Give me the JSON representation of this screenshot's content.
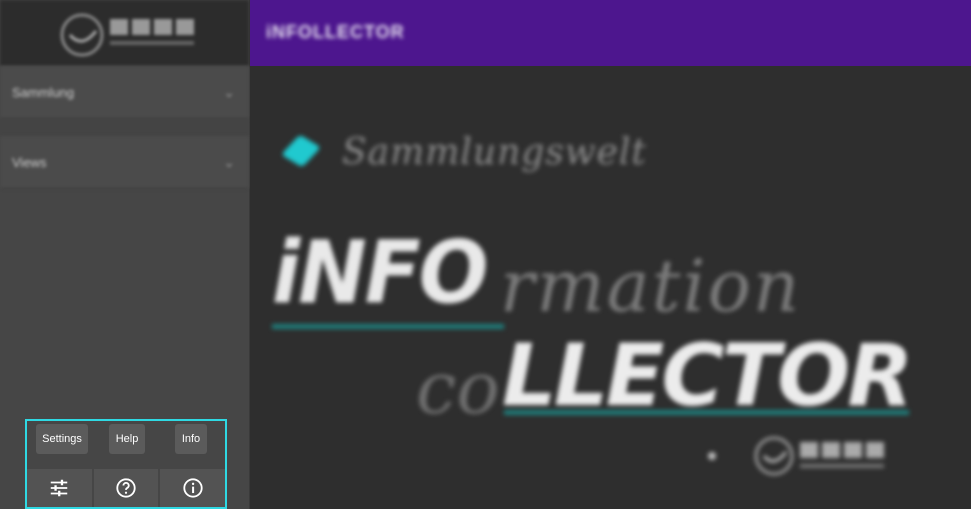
{
  "sidebar": {
    "groups": [
      {
        "label": "Sammlung"
      },
      {
        "label": "Views"
      }
    ]
  },
  "toolbar": {
    "tooltips": {
      "settings": "Settings",
      "help": "Help",
      "info": "Info"
    }
  },
  "header": {
    "title": "iNFOLLECTOR"
  },
  "brand": {
    "subtitle": "Sammlungswelt",
    "word1_bold": "iNFO",
    "word1_script": "rmation",
    "word2_script": "co",
    "word2_bold": "LLECTOR"
  },
  "icons": {
    "logo": "lasp-logo-icon",
    "chevron": "chevron-down-icon",
    "settings": "sliders-icon",
    "help": "help-circle-icon",
    "info": "info-circle-icon"
  },
  "colors": {
    "header": "#4d168e",
    "accent": "#2fd9e3",
    "underline": "#1f7e7c"
  }
}
